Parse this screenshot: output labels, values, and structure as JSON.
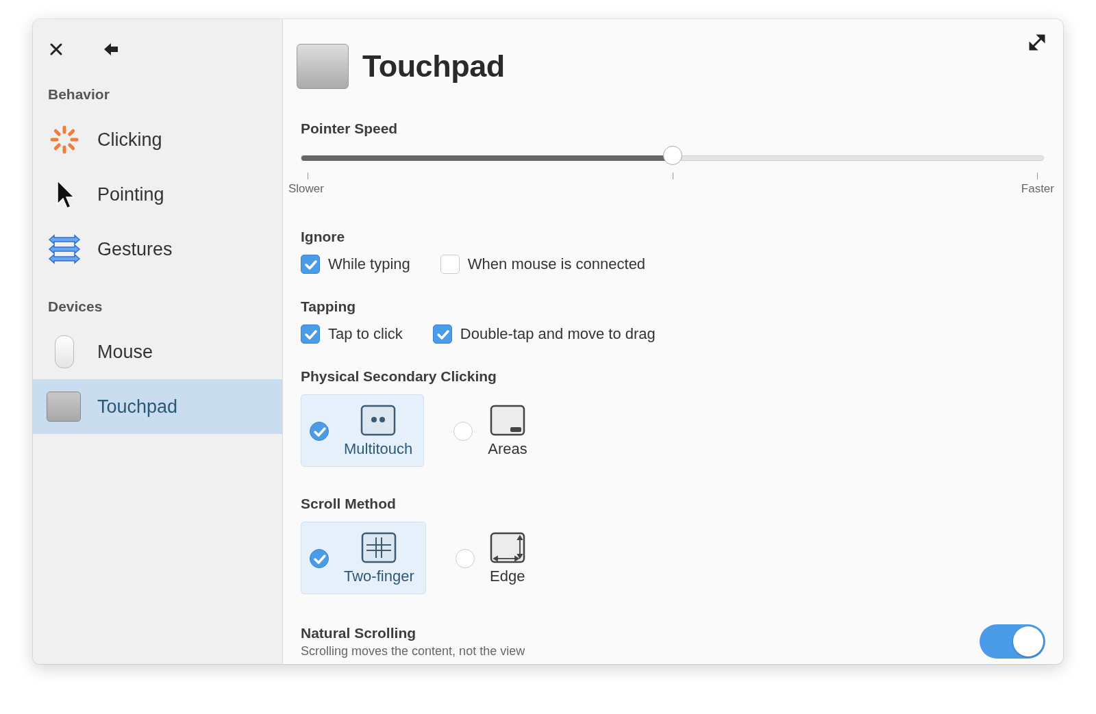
{
  "sidebar": {
    "sections": [
      {
        "title": "Behavior",
        "items": [
          {
            "label": "Clicking",
            "selected": false
          },
          {
            "label": "Pointing",
            "selected": false
          },
          {
            "label": "Gestures",
            "selected": false
          }
        ]
      },
      {
        "title": "Devices",
        "items": [
          {
            "label": "Mouse",
            "selected": false
          },
          {
            "label": "Touchpad",
            "selected": true
          }
        ]
      }
    ]
  },
  "header": {
    "title": "Touchpad"
  },
  "pointer_speed": {
    "title": "Pointer Speed",
    "level": 0.5,
    "min_label": "Slower",
    "max_label": "Faster"
  },
  "checkbox_groups": [
    {
      "title": "Ignore",
      "options": [
        {
          "label": "While typing",
          "checked": true
        },
        {
          "label": "When mouse is connected",
          "checked": false
        }
      ]
    },
    {
      "title": "Tapping",
      "options": [
        {
          "label": "Tap to click",
          "checked": true
        },
        {
          "label": "Double-tap and move to drag",
          "checked": true
        }
      ]
    }
  ],
  "radio_groups": [
    {
      "title": "Physical Secondary Clicking",
      "options": [
        {
          "label": "Multitouch",
          "selected": true
        },
        {
          "label": "Areas",
          "selected": false
        }
      ]
    },
    {
      "title": "Scroll Method",
      "options": [
        {
          "label": "Two-finger",
          "selected": true
        },
        {
          "label": "Edge",
          "selected": false
        }
      ]
    }
  ],
  "natural_scrolling": {
    "title": "Natural Scrolling",
    "description": "Scrolling moves the content, not the view",
    "on": true
  }
}
